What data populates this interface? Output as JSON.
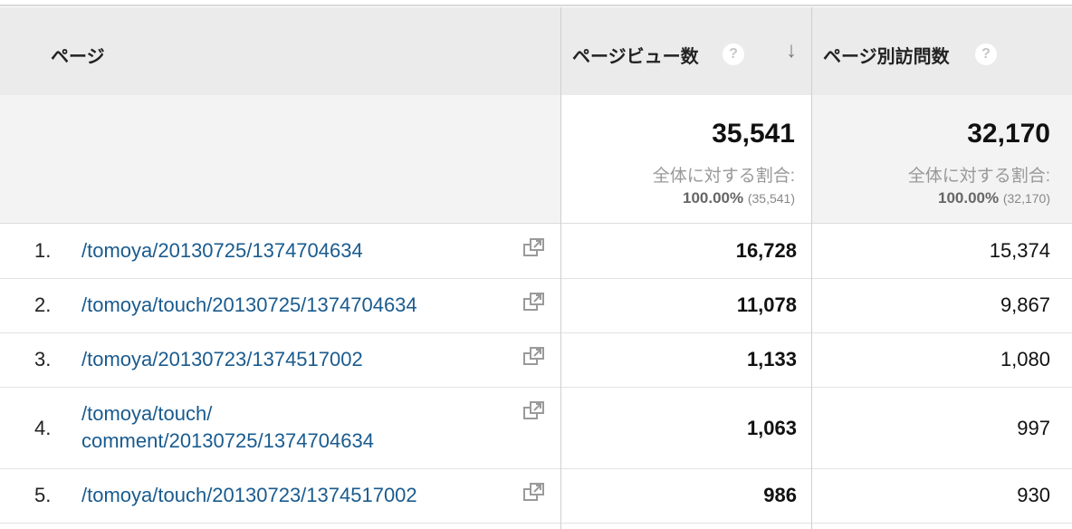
{
  "header": {
    "page": "ページ",
    "pageviews": "ページビュー数",
    "unique_pageviews": "ページ別訪問数",
    "help": "?",
    "sort": "↓"
  },
  "summary": {
    "pageviews_total": "35,541",
    "pageviews_pct_label": "全体に対する割合:",
    "pageviews_pct": "100.00%",
    "pageviews_pct_paren": "(35,541)",
    "unique_total": "32,170",
    "unique_pct_label": "全体に対する割合:",
    "unique_pct": "100.00%",
    "unique_pct_paren": "(32,170)"
  },
  "rows": [
    {
      "index": "1.",
      "page_line1": "/tomoya/20130725/1374704634",
      "page_line2": "",
      "pageviews": "16,728",
      "unique": "15,374"
    },
    {
      "index": "2.",
      "page_line1": "/tomoya/touch/20130725/1374704634",
      "page_line2": "",
      "pageviews": "11,078",
      "unique": "9,867"
    },
    {
      "index": "3.",
      "page_line1": "/tomoya/20130723/1374517002",
      "page_line2": "",
      "pageviews": "1,133",
      "unique": "1,080"
    },
    {
      "index": "4.",
      "page_line1": "/tomoya/touch/",
      "page_line2": "comment/20130725/1374704634",
      "pageviews": "1,063",
      "unique": "997"
    },
    {
      "index": "5.",
      "page_line1": "/tomoya/touch/20130723/1374517002",
      "page_line2": "",
      "pageviews": "986",
      "unique": "930"
    }
  ],
  "icons": {
    "popout": "popout-icon",
    "help": "help-icon",
    "sort": "sort-desc-icon"
  }
}
